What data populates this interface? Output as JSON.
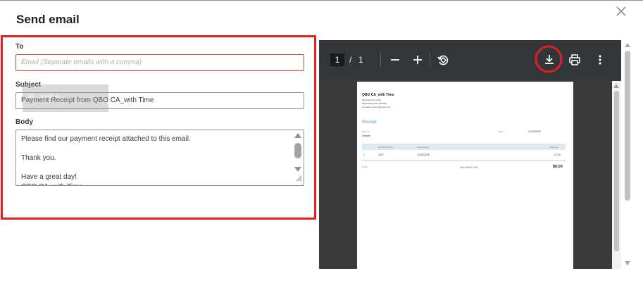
{
  "dialog": {
    "title": "Send email",
    "close_icon": "close-icon"
  },
  "form": {
    "to": {
      "label": "To",
      "placeholder": "Email (Separate emails with a comma)",
      "value": ""
    },
    "subject": {
      "label": "Subject",
      "value": "Payment Receipt from QBO CA_with Time",
      "drag_ghost": "Mi... email a..."
    },
    "body": {
      "label": "Body",
      "value": "Please find our payment receipt attached to this email.\n\nThank you.\n\nHave a great day!\nQBO CA_with Time"
    }
  },
  "highlight_color": "#e02020",
  "pdf_viewer": {
    "current_page": "1",
    "separator": "/",
    "total_pages": "1",
    "icons": [
      "zoom-out-icon",
      "zoom-in-icon",
      "rotate-icon",
      "download-icon",
      "print-icon",
      "more-vert-icon"
    ]
  },
  "receipt": {
    "company": "QBO CA_with Time",
    "address_line1": "3130 Spectrum Way",
    "address_line2": "Mississauga ON  L4W 5B2",
    "email": "anastasia_labonte@intuit.com",
    "doc_title": "Receipt",
    "bill_to_label": "BILL TO",
    "bill_to_value": "Sample",
    "date_label": "Date",
    "date_value": "21/04/2025",
    "table_headers": [
      "Invoice Number",
      "Invoice Date",
      "Payment"
    ],
    "rows": [
      {
        "index": "1",
        "invoice_number": "1007",
        "invoice_date": "21/04/2025",
        "payment": "21.00"
      }
    ],
    "notes_label": "Notes",
    "balance_due_label": "BALANCE DUE",
    "balance_due_value": "$0.00"
  }
}
